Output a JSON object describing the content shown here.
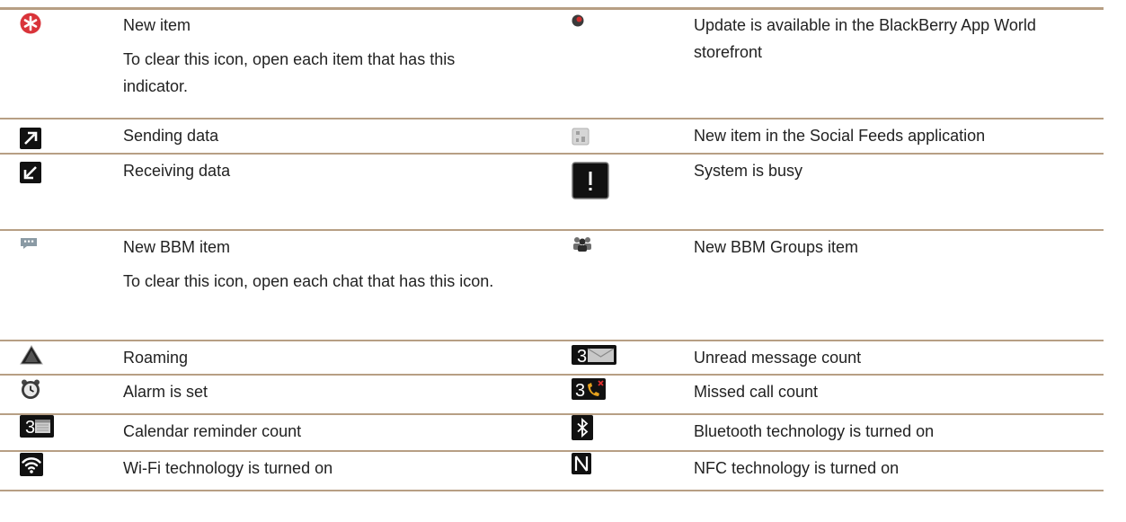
{
  "left": [
    {
      "icon": "new-item-star-icon",
      "lines": [
        "New item",
        "To clear this icon, open each item that has this indicator."
      ]
    },
    {
      "icon": "sending-data-arrow-icon",
      "lines": [
        "Sending data"
      ]
    },
    {
      "icon": "receiving-data-arrow-icon",
      "lines": [
        "Receiving data"
      ]
    },
    {
      "icon": "bbm-chat-icon",
      "lines": [
        "New BBM item",
        "To clear this icon, open each chat that has this icon."
      ]
    },
    {
      "icon": "roaming-triangle-icon",
      "lines": [
        "Roaming"
      ]
    },
    {
      "icon": "alarm-clock-icon",
      "lines": [
        "Alarm is set"
      ]
    },
    {
      "icon": "calendar-count-icon",
      "count": "3",
      "lines": [
        "Calendar reminder count"
      ]
    },
    {
      "icon": "wifi-icon",
      "lines": [
        "Wi-Fi technology is turned on"
      ]
    }
  ],
  "right": [
    {
      "icon": "app-world-update-icon",
      "lines": [
        "Update is available in the BlackBerry App World storefront"
      ]
    },
    {
      "icon": "social-feeds-icon",
      "lines": [
        "New item in the Social Feeds application"
      ]
    },
    {
      "icon": "hourglass-busy-icon",
      "lines": [
        "System is busy"
      ]
    },
    {
      "icon": "bbm-groups-icon",
      "lines": [
        "New BBM Groups item"
      ]
    },
    {
      "icon": "unread-message-icon",
      "count": "3",
      "lines": [
        "Unread message count"
      ]
    },
    {
      "icon": "missed-call-icon",
      "count": "3",
      "lines": [
        "Missed call count"
      ]
    },
    {
      "icon": "bluetooth-icon",
      "lines": [
        "Bluetooth technology is turned on"
      ]
    },
    {
      "icon": "nfc-icon",
      "lines": [
        "NFC technology is turned on"
      ]
    }
  ]
}
